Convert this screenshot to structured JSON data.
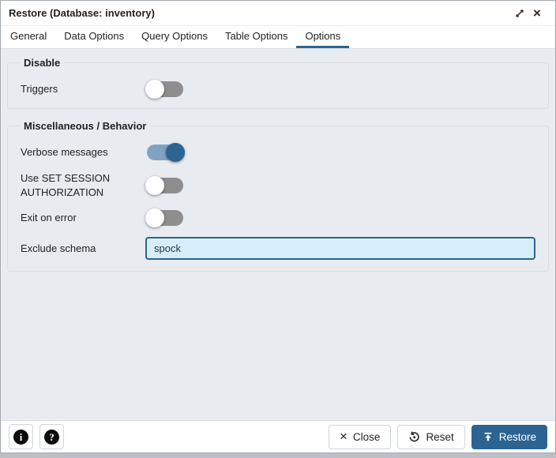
{
  "window": {
    "title": "Restore (Database: inventory)",
    "controls": {
      "maximize_icon": "expand-diagonal",
      "close_icon": "close-x",
      "close_glyph": "×"
    }
  },
  "tabs": [
    {
      "label": "General",
      "active": false
    },
    {
      "label": "Data Options",
      "active": false
    },
    {
      "label": "Query Options",
      "active": false
    },
    {
      "label": "Table Options",
      "active": false
    },
    {
      "label": "Options",
      "active": true
    }
  ],
  "sections": [
    {
      "legend": "Disable",
      "rows": [
        {
          "label": "Triggers",
          "control": "toggle",
          "state": "off"
        }
      ]
    },
    {
      "legend": "Miscellaneous / Behavior",
      "rows": [
        {
          "label": "Verbose messages",
          "control": "toggle",
          "state": "on"
        },
        {
          "label": "Use SET SESSION AUTHORIZATION",
          "control": "toggle",
          "state": "off"
        },
        {
          "label": "Exit on error",
          "control": "toggle",
          "state": "off"
        },
        {
          "label": "Exclude schema",
          "control": "text-input",
          "value": "spock"
        }
      ]
    }
  ],
  "footer": {
    "info_glyph": "i",
    "help_glyph": "?",
    "close_label": "Close",
    "close_glyph": "×",
    "reset_label": "Reset",
    "restore_label": "Restore"
  },
  "colors": {
    "accent": "#2c6491",
    "toggle_on_track": "#7fa3c1",
    "toggle_off_track": "#8e8e8e",
    "input_bg": "#d7edfa",
    "input_border": "#2c6491",
    "content_bg": "#e8ebef",
    "tab_underline": "#2c6491"
  }
}
